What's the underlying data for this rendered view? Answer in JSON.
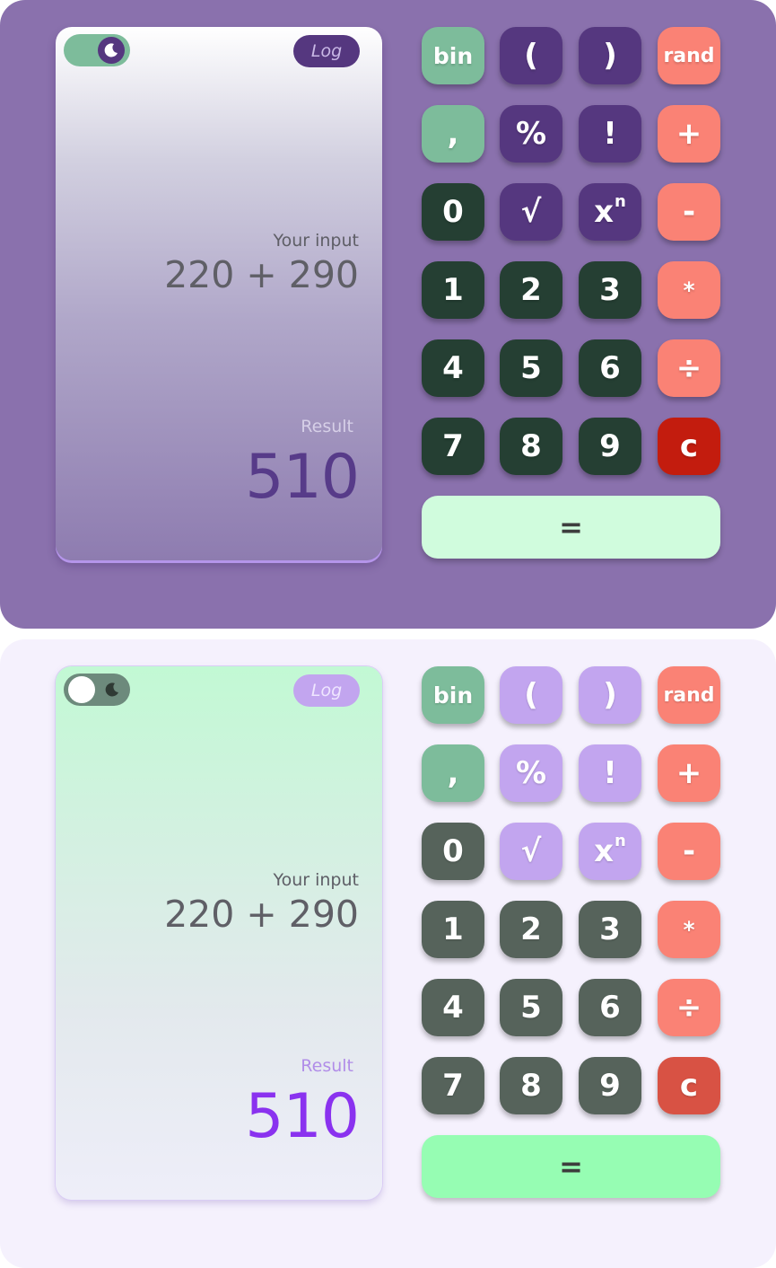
{
  "calculators": [
    {
      "theme": "dark",
      "display": {
        "log_label": "Log",
        "input_label": "Your input",
        "input_value": "220 + 290",
        "result_label": "Result",
        "result_value": "510"
      }
    },
    {
      "theme": "light",
      "display": {
        "log_label": "Log",
        "input_label": "Your input",
        "input_value": "220 + 290",
        "result_label": "Result",
        "result_value": "510"
      }
    }
  ],
  "keys": {
    "bin": "bin",
    "open_paren": "(",
    "close_paren": ")",
    "rand": "rand",
    "comma": ",",
    "percent": "%",
    "factorial": "!",
    "plus": "+",
    "zero": "0",
    "sqrt": "√",
    "power_base": "x",
    "power_exp": "n",
    "minus": "-",
    "one": "1",
    "two": "2",
    "three": "3",
    "multiply": "*",
    "four": "4",
    "five": "5",
    "six": "6",
    "divide": "÷",
    "seven": "7",
    "eight": "8",
    "nine": "9",
    "clear": "c",
    "equals": "="
  },
  "icons": {
    "theme_toggle": "moon-icon"
  },
  "colors": {
    "dark_background": "#8a71ad",
    "light_background": "#f5f1fd",
    "mint": "#7dbc9b",
    "coral": "#fa8275",
    "dark_purple": "#55377f",
    "dark_green": "#253f33",
    "dark_result": "#573b89",
    "light_result": "#8a32ef"
  }
}
